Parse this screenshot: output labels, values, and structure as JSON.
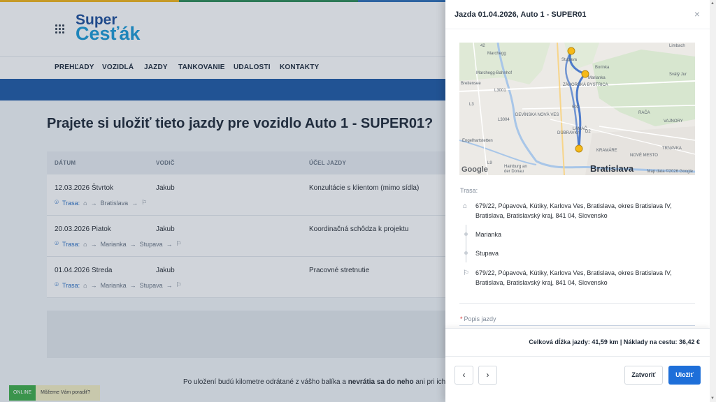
{
  "app": {
    "logo_top": "Super",
    "logo_bottom": "Cesťák"
  },
  "nav": {
    "items": [
      {
        "label": "PREHĽADY"
      },
      {
        "label": "VOZIDLÁ"
      },
      {
        "label": "JAZDY"
      },
      {
        "label": "TANKOVANIE"
      },
      {
        "label": "UDALOSTI"
      },
      {
        "label": "KONTAKTY"
      }
    ]
  },
  "main": {
    "title": "Prajete si uložiť tieto jazdy pre vozidlo Auto 1 - SUPER01?",
    "columns": {
      "date": "DÁTUM",
      "driver": "VODIČ",
      "purpose": "ÚČEL JAZDY"
    },
    "trasa_label": "Trasa:",
    "rows": [
      {
        "date": "12.03.2026",
        "day": "Štvrtok",
        "driver": "Jakub",
        "purpose": "Konzultácie s klientom (mimo sídla)",
        "route": [
          "Bratislava"
        ]
      },
      {
        "date": "20.03.2026",
        "day": "Piatok",
        "driver": "Jakub",
        "purpose": "Koordinačná schôdza k projektu",
        "route": [
          "Marianka",
          "Stupava"
        ]
      },
      {
        "date": "01.04.2026",
        "day": "Streda",
        "driver": "Jakub",
        "purpose": "Pracovné stretnutie",
        "route": [
          "Marianka",
          "Stupava"
        ]
      }
    ],
    "footer_note_pre": "Po uložení budú kilometre odrátané z vášho balíka a ",
    "footer_note_bold": "nevrátia sa do neho",
    "footer_note_post": " ani pri ich pri"
  },
  "chat": {
    "online": "ONLINE",
    "help": "Môžeme Vám poradiť?"
  },
  "drawer": {
    "title": "Jazda 01.04.2026, Auto 1 - SUPER01",
    "close_icon": "×",
    "map": {
      "city": "Bratislava",
      "google": "Google",
      "map_data": "Map data ©2026 Google",
      "labels": {
        "limbach": "Limbach",
        "marchegg": "Marchegg",
        "stupava": "Stupava",
        "borinka": "Borinka",
        "marchegg_bahnhof": "Marchegg-Bahnhof",
        "marianka": "Marianka",
        "svaty_jur": "Svätý Jur",
        "breitensee": "Breitensee",
        "zahorska": "ZÁHORSKÁ BYSTRICA",
        "devinska": "DEVÍNSKA NOVÁ VES",
        "raca": "RAČA",
        "vajnory": "VAJNORY",
        "lamac": "LAMAČ",
        "dubravka": "DÚBRAVKA",
        "engelhartstetten": "Engelhartstetten",
        "kramare": "KRAMÁRE",
        "nove_mesto": "NOVÉ MESTO",
        "trnavka": "TRNAVKA",
        "hainburg": "Hainburg an der Donau",
        "r42": "42",
        "rl3001": "L3001",
        "rl3004": "L3004",
        "rl3": "L3",
        "rl9": "L9",
        "rd2": "D2",
        "r502": "502"
      }
    },
    "trasa_label": "Trasa:",
    "stops": [
      {
        "icon": "home-icon",
        "text": "679/22, Púpavová, Kútiky, Karlova Ves, Bratislava, okres Bratislava IV, Bratislava, Bratislavský kraj, 841 04, Slovensko"
      },
      {
        "icon": "waypoint-icon",
        "text": "Marianka"
      },
      {
        "icon": "waypoint-icon",
        "text": "Stupava"
      },
      {
        "icon": "flag-icon",
        "text": "679/22, Púpavová, Kútiky, Karlova Ves, Bratislava, okres Bratislava IV, Bratislava, Bratislavský kraj, 841 04, Slovensko"
      }
    ],
    "popis_label": "Popis jazdy",
    "summary": "Celková dĺžka jazdy: 41,59 km  |  Náklady na cestu: 36,42 €",
    "prev_label": "‹",
    "next_label": "›",
    "close_label": "Zatvoriť",
    "save_label": "Uložiť"
  },
  "colors": {
    "accent": "#1e6fd9",
    "brand_dark": "#1e4f9a",
    "brand_light": "#1c9ad6",
    "nav_blue": "#1f5aa6"
  }
}
